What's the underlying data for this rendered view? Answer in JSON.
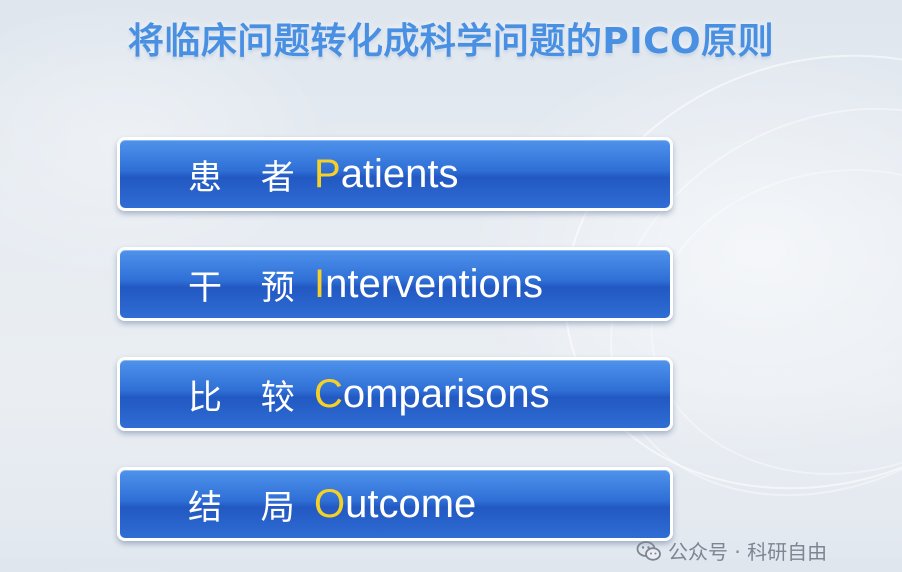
{
  "slide": {
    "title": "将临床问题转化成科学问题的PICO原则",
    "items": [
      {
        "cn": "患 者",
        "letter": "P",
        "rest": "atients"
      },
      {
        "cn": "干 预",
        "letter": "I",
        "rest": "nterventions"
      },
      {
        "cn": "比 较",
        "letter": "C",
        "rest": "omparisons"
      },
      {
        "cn": "结 局",
        "letter": "O",
        "rest": "utcome"
      }
    ],
    "watermark": "公众号 · 科研自由"
  },
  "colors": {
    "title": "#4a90e2",
    "box_blue": "#2f6fd6",
    "highlight_letter": "#f5d128",
    "border": "#ffffff"
  },
  "icons": {
    "watermark": "wechat-icon"
  }
}
